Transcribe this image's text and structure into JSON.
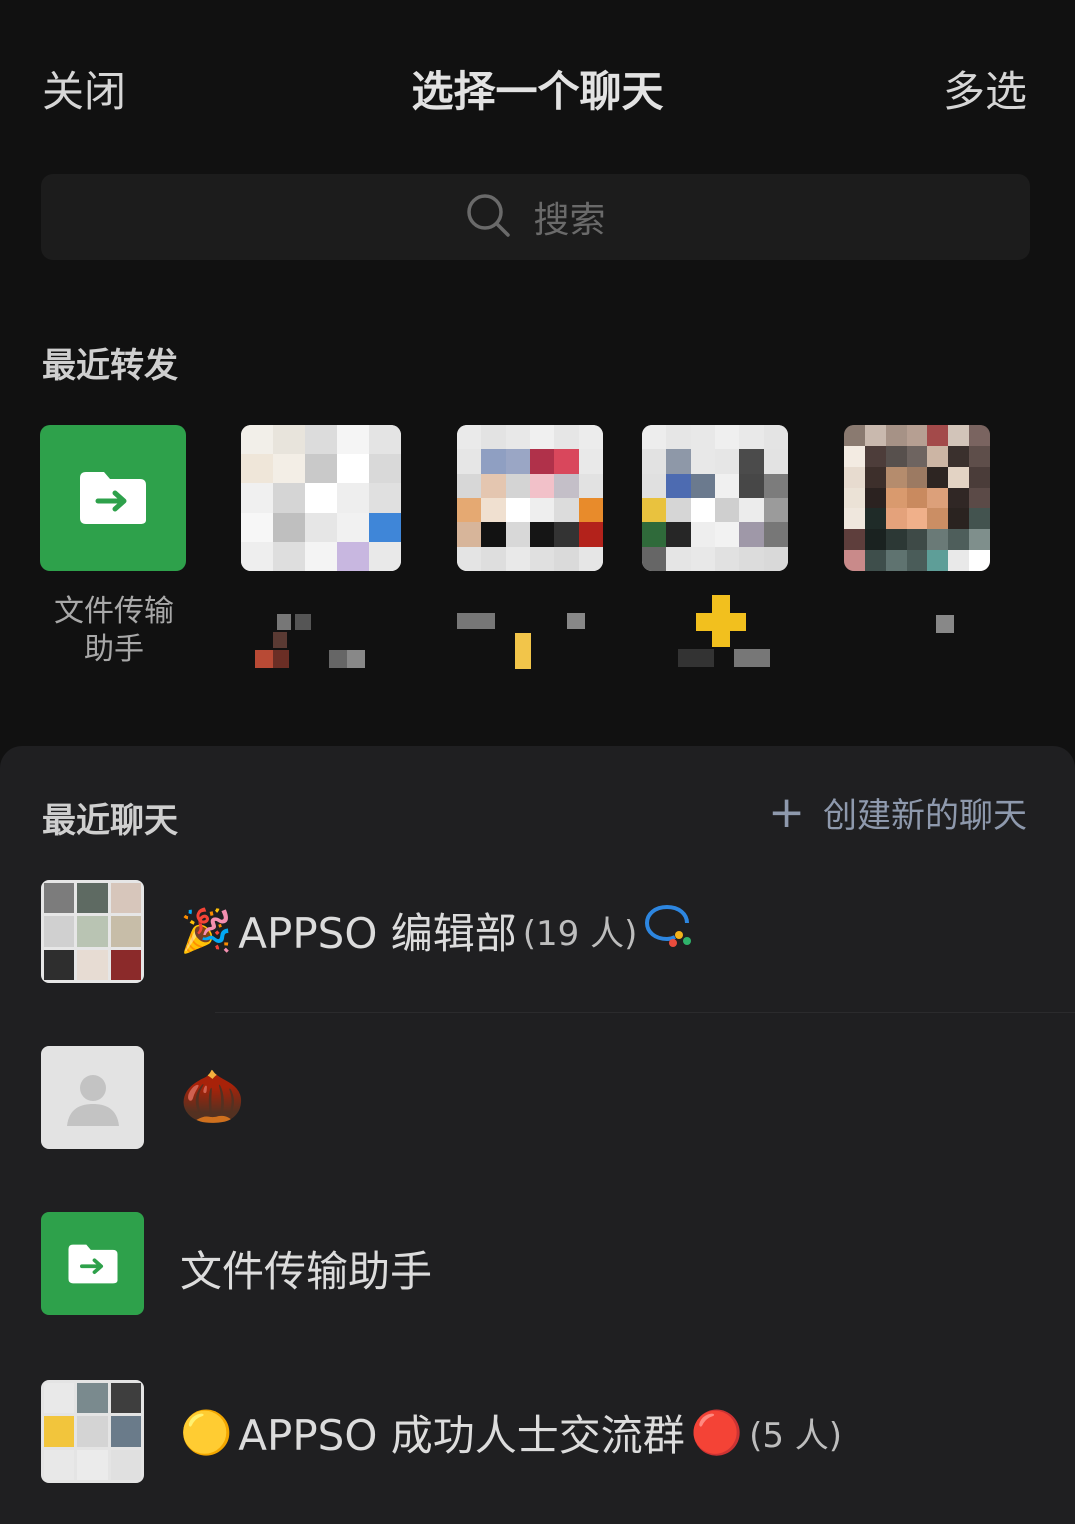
{
  "header": {
    "close_label": "关闭",
    "title": "选择一个聊天",
    "multi_select_label": "多选"
  },
  "search": {
    "placeholder": "搜索"
  },
  "recent_forward": {
    "section_title": "最近转发",
    "items": [
      {
        "label": "文件传输\n助手",
        "icon": "folder-forward-icon"
      },
      {
        "label": "",
        "icon": "pixelated-group-avatar"
      },
      {
        "label": "",
        "icon": "pixelated-group-avatar"
      },
      {
        "label": "",
        "icon": "pixelated-group-avatar"
      },
      {
        "label": "",
        "icon": "pixelated-person-avatar"
      }
    ]
  },
  "recent_chats": {
    "section_title": "最近聊天",
    "create_label": "创建新的聊天",
    "chats": [
      {
        "prefix_emoji": "🎉",
        "name": "APPSO 编辑部",
        "count": "(19 人)",
        "suffix_icon": "enterprise-chat-icon"
      },
      {
        "prefix_emoji": "🌰",
        "name": "",
        "count": ""
      },
      {
        "prefix_emoji": "",
        "name": "文件传输助手",
        "count": ""
      },
      {
        "prefix_emoji": "🟡",
        "name": "APPSO 成功人士交流群",
        "suffix_emoji": "🔴",
        "count": "(5 人)"
      }
    ]
  },
  "colors": {
    "background": "#111111",
    "sheet": "#1f1f21",
    "accent_green": "#2ea14b",
    "link_blue_gray": "#8e99ad"
  }
}
